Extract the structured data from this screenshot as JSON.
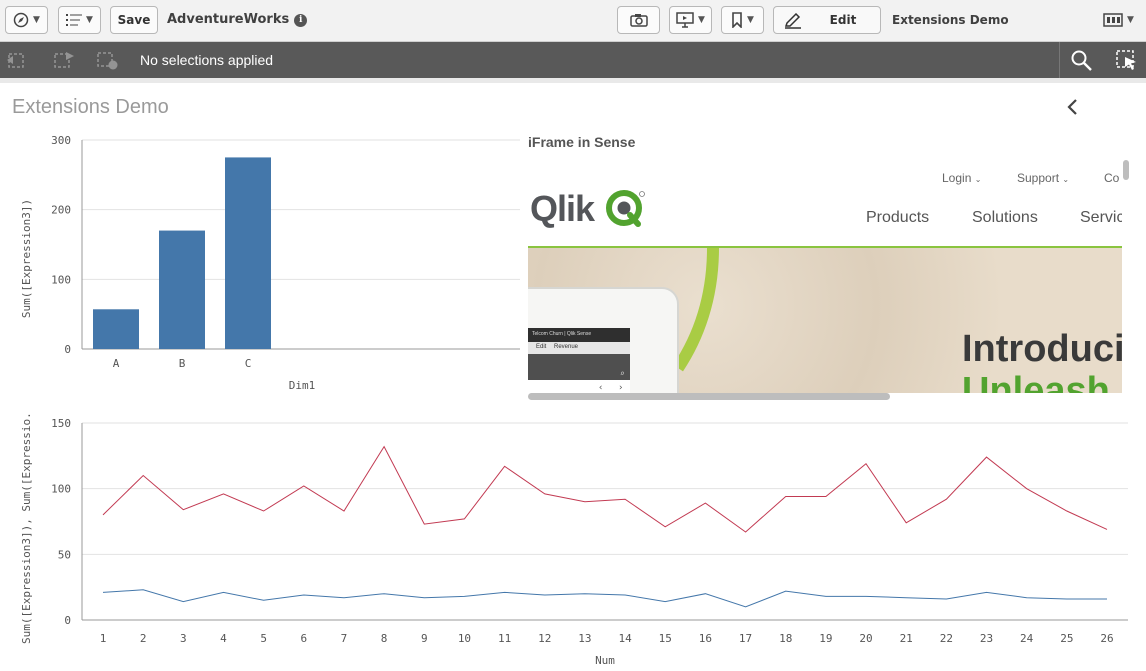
{
  "toolbar": {
    "save_label": "Save",
    "app_name": "AdventureWorks",
    "info_glyph": "i",
    "edit_label": "Edit",
    "sheet_name": "Extensions Demo",
    "icons": [
      "compass-icon",
      "list-icon",
      "camera-icon",
      "presentation-icon",
      "bookmark-icon",
      "pencil-icon",
      "sheet-icon"
    ]
  },
  "selections": {
    "text": "No selections applied",
    "icons": [
      "step-back-icon",
      "step-forward-icon",
      "clear-selections-icon",
      "search-icon",
      "selections-tool-icon"
    ]
  },
  "sheet": {
    "title": "Extensions Demo"
  },
  "iframe": {
    "title": "iFrame in Sense",
    "logo_text": "Qlik",
    "top_links": [
      "Login",
      "Support",
      "Co"
    ],
    "nav_links": [
      "Products",
      "Solutions",
      "Servic"
    ],
    "hero_line1": "Introduci",
    "hero_line2": "Unleash",
    "tablet_tab": "Telcom Churn | Qlik Sense",
    "tablet_edit": "Edit",
    "tablet_revenue": "Revenue"
  },
  "chart_data": [
    {
      "type": "bar",
      "categories": [
        "A",
        "B",
        "C"
      ],
      "values": [
        57,
        170,
        275
      ],
      "xlabel": "Dim1",
      "ylabel": "Sum([Expression3])",
      "ylim": [
        0,
        300
      ],
      "yticks": [
        0,
        100,
        200,
        300
      ],
      "grid": true,
      "color": "#4477aa"
    },
    {
      "type": "line",
      "x": [
        1,
        2,
        3,
        4,
        5,
        6,
        7,
        8,
        9,
        10,
        11,
        12,
        13,
        14,
        15,
        16,
        17,
        18,
        19,
        20,
        21,
        22,
        23,
        24,
        25,
        26
      ],
      "series": [
        {
          "color": "#c23a52",
          "values": [
            80,
            110,
            84,
            96,
            83,
            102,
            83,
            132,
            73,
            77,
            117,
            96,
            90,
            92,
            71,
            89,
            67,
            94,
            94,
            119,
            74,
            92,
            124,
            100,
            83,
            69
          ]
        },
        {
          "color": "#4477aa",
          "values": [
            21,
            23,
            14,
            21,
            15,
            19,
            17,
            20,
            17,
            18,
            21,
            19,
            20,
            19,
            14,
            20,
            10,
            22,
            18,
            18,
            17,
            16,
            21,
            17,
            16,
            16
          ]
        }
      ],
      "xlabel": "Num",
      "ylabel": "Sum([Expression3]), Sum([Expressio...",
      "ylim": [
        0,
        150
      ],
      "yticks": [
        0,
        50,
        100,
        150
      ],
      "grid": true
    }
  ]
}
